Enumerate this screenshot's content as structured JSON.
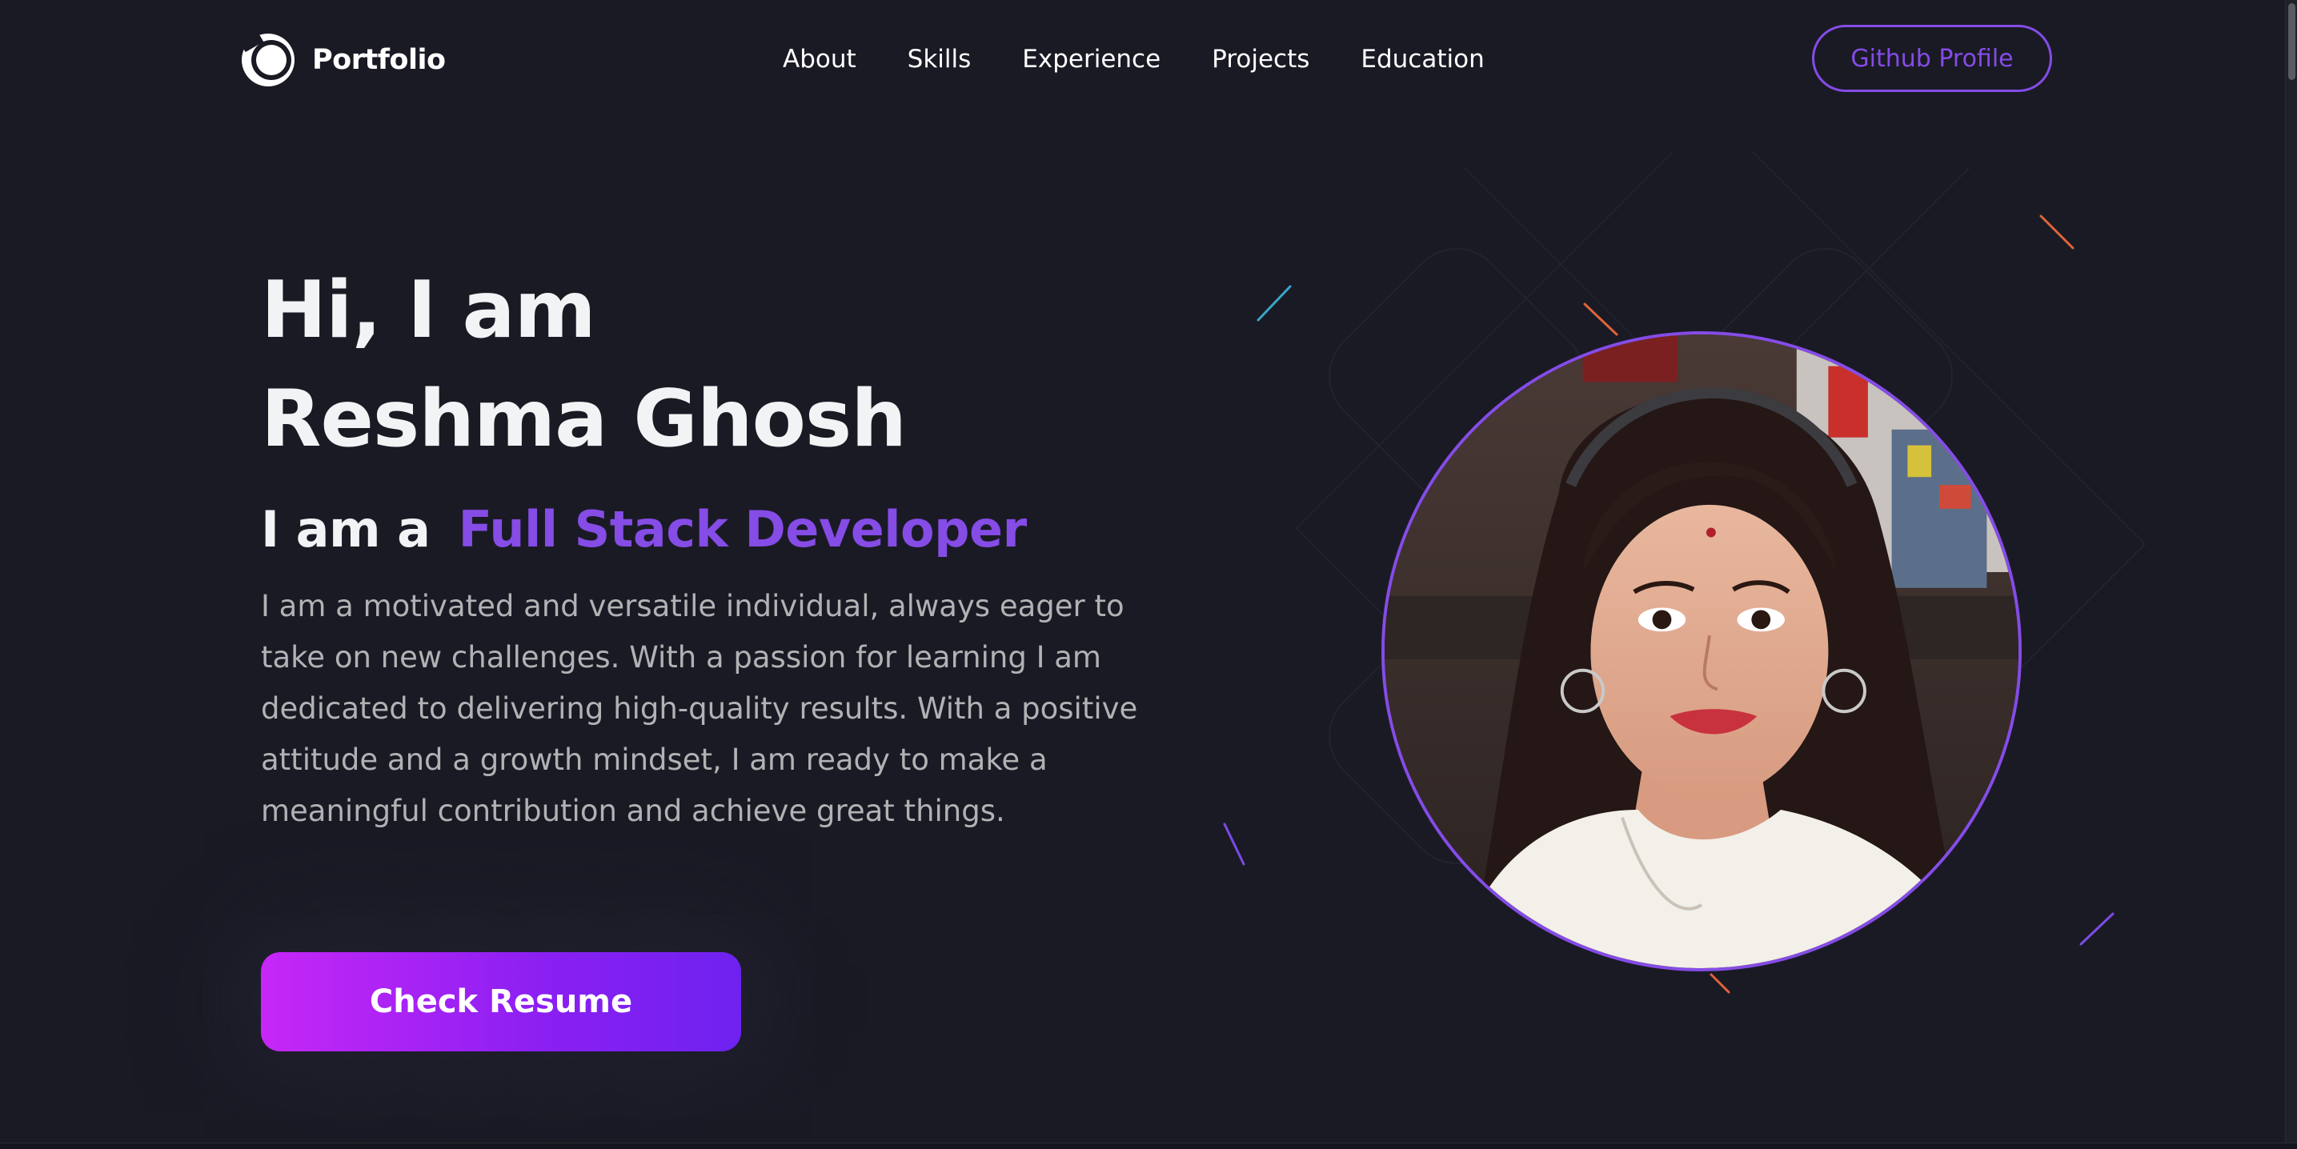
{
  "navbar": {
    "logo_text": "Portfolio",
    "links": [
      "About",
      "Skills",
      "Experience",
      "Projects",
      "Education"
    ],
    "github_label": "Github Profile"
  },
  "hero": {
    "title_line1": "Hi, I am",
    "title_line2": "Reshma Ghosh",
    "role_prefix": "I am a",
    "role": "Full Stack Developer",
    "description": "I am a motivated and versatile individual, always eager to take on new challenges. With a passion for learning I am dedicated to delivering high-quality results. With a positive attitude and a growth mindset, I am ready to make a meaningful contribution and achieve great things.",
    "resume_label": "Check Resume"
  },
  "colors": {
    "background": "#1a1a25",
    "accent": "#854ce6",
    "button_gradient_start": "#c627f6",
    "button_gradient_end": "#6e22f0",
    "text_primary": "#f2f3f4",
    "text_secondary": "#b1b2b3"
  },
  "icons": {
    "logo": "circle-logo-icon"
  }
}
